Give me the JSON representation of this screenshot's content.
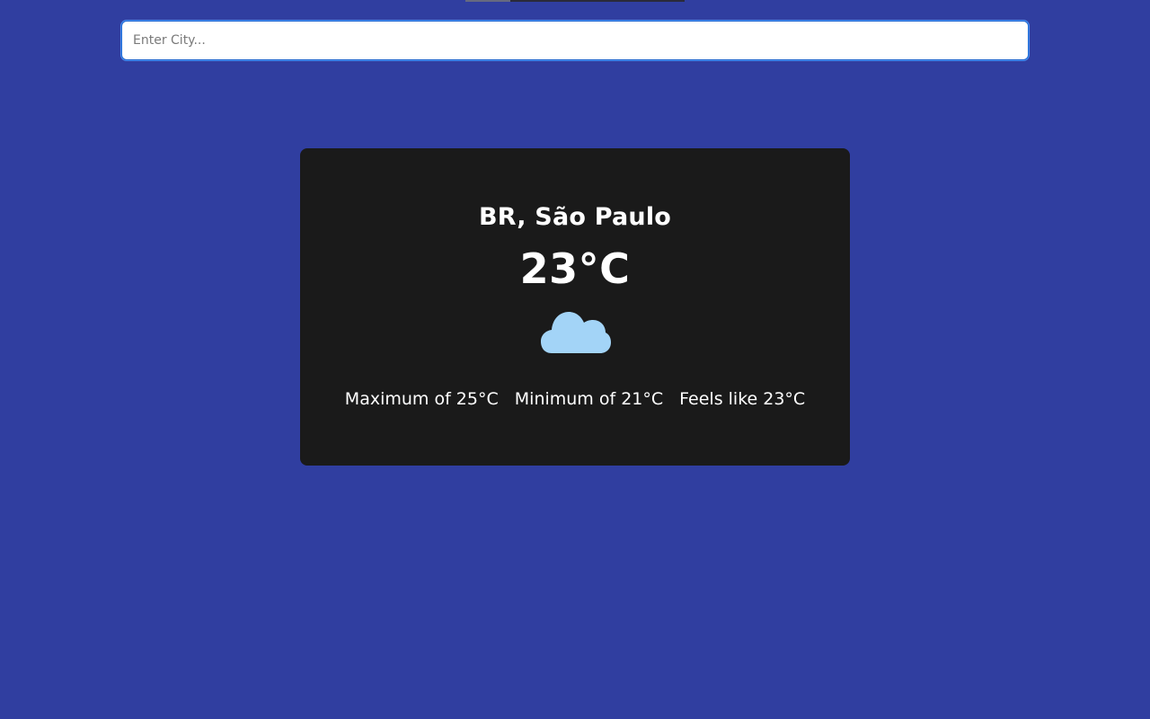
{
  "search": {
    "placeholder": "Enter City...",
    "value": ""
  },
  "weather": {
    "location": "BR, São Paulo",
    "temperature": "23°C",
    "condition_icon": "cloud-icon",
    "maximum": "Maximum of 25°C",
    "minimum": "Minimum of 21°C",
    "feels_like": "Feels like 23°C"
  },
  "colors": {
    "background": "#303ea0",
    "card": "#1a1a1a",
    "cloud": "#a3d4f7",
    "text": "#ffffff"
  }
}
